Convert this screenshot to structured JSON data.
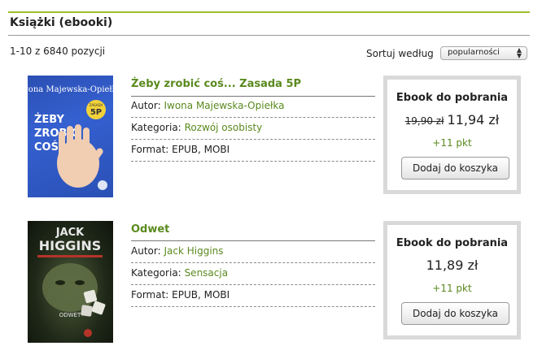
{
  "header": {
    "title": "Książki (ebooki)"
  },
  "listing": {
    "count_text": "1-10 z 6840 pozycji",
    "sort_label": "Sortuj według",
    "sort_value": "popularności"
  },
  "books": [
    {
      "title": "Żeby zrobić coś... Zasada 5P",
      "author_label": "Autor:",
      "author": "Iwona Majewska-Opiełka",
      "category_label": "Kategoria:",
      "category": "Rozwój osobisty",
      "format_label": "Format:",
      "format": "EPUB, MOBI",
      "box_label": "Ebook do pobrania",
      "old_price": "19,90 zł",
      "price": "11,94 zł",
      "points": "+11 pkt",
      "button": "Dodaj do koszyka",
      "cover": {
        "author": "Iwona Majewska-Opiełka",
        "title_lines": [
          "ŻEBY",
          "ZROBIĆ",
          "COŚ..."
        ],
        "badge_top": "ZASADA",
        "badge_main": "5P"
      }
    },
    {
      "title": "Odwet",
      "author_label": "Autor:",
      "author": "Jack Higgins",
      "category_label": "Kategoria:",
      "category": "Sensacja",
      "format_label": "Format:",
      "format": "EPUB, MOBI",
      "box_label": "Ebook do pobrania",
      "old_price": "",
      "price": "11,89 zł",
      "points": "+11 pkt",
      "button": "Dodaj do koszyka",
      "cover": {
        "author_first": "JACK",
        "author_last": "HIGGINS",
        "title": "ODWET"
      }
    }
  ],
  "colors": {
    "accent": "#9fbd2b",
    "link": "#5a8a1e",
    "box_border": "#d9d9d9"
  }
}
